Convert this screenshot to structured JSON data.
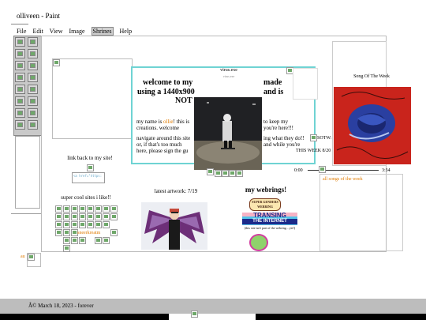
{
  "window": {
    "title": "olliveen - Paint"
  },
  "menu": [
    "File",
    "Edit",
    "View",
    "Image",
    "Shrines",
    "Help"
  ],
  "popup": {
    "title": "virus.exe",
    "subtitle": "virus.exe"
  },
  "welcome": {
    "heading_line1": "welcome to my",
    "heading_line1_end": "made",
    "heading_line2": "using a 1440x900",
    "heading_line2_end": "and is",
    "heading_line3": "NOT",
    "p1a": "my name is ",
    "p1_name": "ollie",
    "p1b": "! this is",
    "p1c": "to keep my",
    "p1d": "creations. welcome",
    "p1e": "you're here!!!",
    "p2a": "navigate around this site",
    "p2b": "ing what they do!!",
    "p2c": "or, if that's too much",
    "p2d": "and while you're",
    "p2e": "here, please sign the gu",
    "p2e_link": "gu"
  },
  "linkback": {
    "label": "link back to my site!",
    "code": "<a href=\"https:"
  },
  "cool_sites": {
    "label": "super cool sites i like!!",
    "link": "sneerkreatm"
  },
  "artwork": {
    "label": "latest artwork: 7/19"
  },
  "webrings": {
    "heading": "my webrings!",
    "ring1": "SUPER GENDERS WEBRING",
    "ring2_line1": "TRANSING",
    "ring2_line2": "THE INTERNET",
    "note": "(this site isn't part of the webring... yet!)"
  },
  "sotw": {
    "label": "Song Of The Week",
    "side_label": "SOTW:",
    "week": "THIS WEEK 8/20",
    "time_start": "0:00",
    "time_end": "3:34",
    "progress": 0.08,
    "all_songs": "all songs of the week"
  },
  "misc": {
    "side_text": "au"
  },
  "footer": {
    "text": "Â© March 18, 2023 - forever"
  },
  "colors": {
    "accent_cyan": "#6fd3d3",
    "link_orange": "#e07b00",
    "footer_bg": "#bdbdbd",
    "album_red": "#c9241c",
    "album_blue": "#2a3fa0"
  }
}
